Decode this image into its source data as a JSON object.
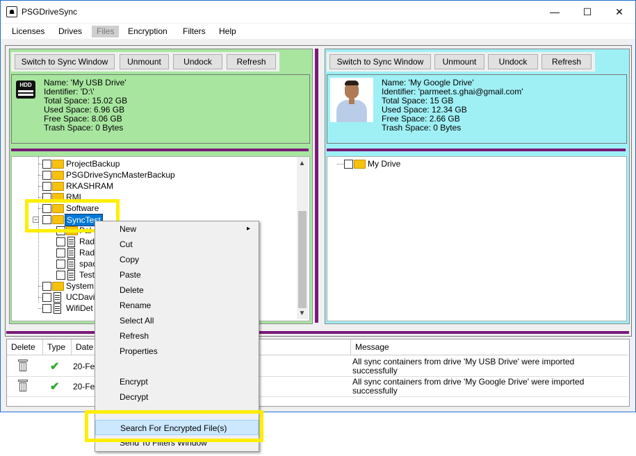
{
  "window": {
    "title": "PSGDriveSync",
    "minimize_glyph": "—",
    "maximize_glyph": "☐",
    "close_glyph": "✕"
  },
  "menu": [
    "Licenses",
    "Drives",
    "Files",
    "Encryption",
    "Filters",
    "Help"
  ],
  "active_menu": "Files",
  "left_pane": {
    "buttons": [
      "Switch to Sync Window",
      "Unmount",
      "Undock",
      "Refresh"
    ],
    "icon": "hdd-icon",
    "icon_label": "HDD",
    "info": [
      "Name: 'My USB Drive'",
      "Identifier: 'D:\\'",
      "Total Space: 15.02 GB",
      "Used Space: 6.96 GB",
      "Free Space: 8.06 GB",
      "Trash Space: 0 Bytes"
    ],
    "tree": [
      {
        "label": "ProjectBackup",
        "type": "folder"
      },
      {
        "label": "PSGDriveSyncMasterBackup",
        "type": "folder"
      },
      {
        "label": "RKASHRAM",
        "type": "folder"
      },
      {
        "label": "RML",
        "type": "folder"
      },
      {
        "label": "Software",
        "type": "folder"
      },
      {
        "label": "SyncTest",
        "type": "folder"
      },
      {
        "label": "Pal",
        "type": "folder"
      },
      {
        "label": "Rad",
        "type": "file"
      },
      {
        "label": "Rad",
        "type": "file"
      },
      {
        "label": "spac",
        "type": "file"
      },
      {
        "label": "Test",
        "type": "file"
      },
      {
        "label": "System",
        "type": "folder"
      },
      {
        "label": "UCDavi",
        "type": "file"
      },
      {
        "label": "WifiDet",
        "type": "file"
      }
    ]
  },
  "right_pane": {
    "buttons": [
      "Switch to Sync Window",
      "Unmount",
      "Undock",
      "Refresh"
    ],
    "icon": "user-avatar",
    "info": [
      "Name: 'My Google Drive'",
      "Identifier: 'parmeet.s.ghai@gmail.com'",
      "Total Space: 15 GB",
      "Used Space: 12.34 GB",
      "Free Space: 2.66 GB",
      "Trash Space: 0 Bytes"
    ],
    "tree": [
      {
        "label": "My Drive",
        "type": "folder"
      }
    ]
  },
  "log": {
    "headers": [
      "Delete",
      "Type",
      "Date",
      "Message"
    ],
    "rows": [
      {
        "date": "20-Fe",
        "message": "All sync containers from drive 'My USB Drive' were imported successfully"
      },
      {
        "date": "20-Fe",
        "message": "All sync containers from drive 'My Google Drive' were imported successfully"
      }
    ]
  },
  "context_menu": {
    "items": [
      "New",
      "Cut",
      "Copy",
      "Paste",
      "Delete",
      "Rename",
      "Select All",
      "Refresh",
      "Properties",
      "",
      "Encrypt",
      "Decrypt",
      "",
      "Search For Encrypted File(s)",
      "Send To Filters Window"
    ],
    "submenu_arrow": "▸",
    "highlighted": "Search For Encrypted File(s)"
  },
  "colors": {
    "left_accent": "#a8e6a0",
    "right_accent": "#9ff0f5",
    "divider": "#7a1a7a",
    "highlight_box": "#ffee00"
  }
}
